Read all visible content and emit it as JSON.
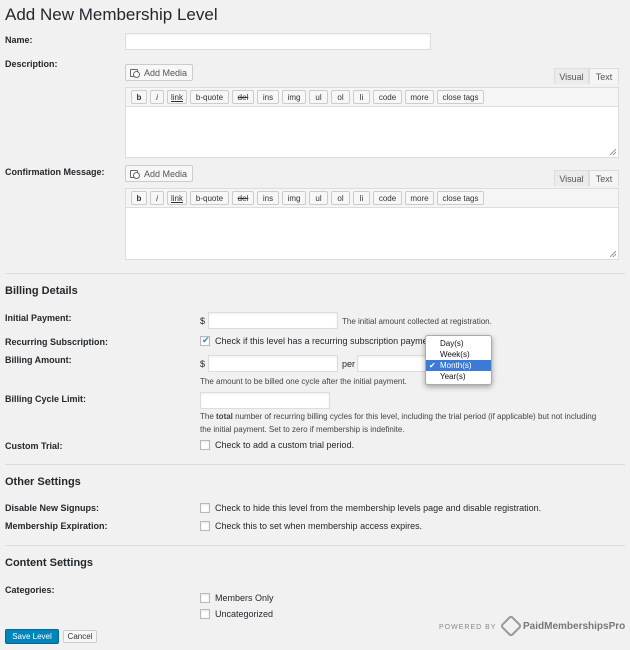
{
  "title": "Add New Membership Level",
  "fields": {
    "name": {
      "label": "Name:",
      "value": ""
    },
    "description": {
      "label": "Description:"
    },
    "confirmation": {
      "label": "Confirmation Message:"
    }
  },
  "editor": {
    "add_media": "Add Media",
    "tab_visual": "Visual",
    "tab_text": "Text",
    "quicktags": [
      "b",
      "i",
      "link",
      "b-quote",
      "del",
      "ins",
      "img",
      "ul",
      "ol",
      "li",
      "code",
      "more",
      "close tags"
    ]
  },
  "billing": {
    "heading": "Billing Details",
    "initial_payment": {
      "label": "Initial Payment:",
      "currency": "$",
      "help": "The initial amount collected at registration."
    },
    "recurring": {
      "label": "Recurring Subscription:",
      "checkbox": "Check if this level has a recurring subscription payment."
    },
    "billing_amount": {
      "label": "Billing Amount:",
      "currency": "$",
      "per": "per",
      "help": "The amount to be billed one cycle after the initial payment."
    },
    "period_options": [
      "Day(s)",
      "Week(s)",
      "Month(s)",
      "Year(s)"
    ],
    "period_selected": "Month(s)",
    "cycle_limit": {
      "label": "Billing Cycle Limit:",
      "help_bold": "total",
      "help_before": "The ",
      "help_after": " number of recurring billing cycles for this level, including the trial period (if applicable) but not including",
      "help_line2": "the initial payment. Set to zero if membership is indefinite."
    },
    "custom_trial": {
      "label": "Custom Trial:",
      "checkbox": "Check to add a custom trial period."
    }
  },
  "other": {
    "heading": "Other Settings",
    "disable_signups": {
      "label": "Disable New Signups:",
      "checkbox": "Check to hide this level from the membership levels page and disable registration."
    },
    "expiration": {
      "label": "Membership Expiration:",
      "checkbox": "Check this to set when membership access expires."
    }
  },
  "content": {
    "heading": "Content Settings",
    "categories_label": "Categories:",
    "categories": [
      "Members Only",
      "Uncategorized"
    ]
  },
  "actions": {
    "save": "Save Level",
    "cancel": "Cancel"
  },
  "footer": {
    "powered_by": "POWERED BY",
    "brand": "PaidMembershipsPro"
  },
  "colors": {
    "primary": "#0085ba",
    "selection": "#3b7bd6",
    "background": "#f1f1f1"
  }
}
